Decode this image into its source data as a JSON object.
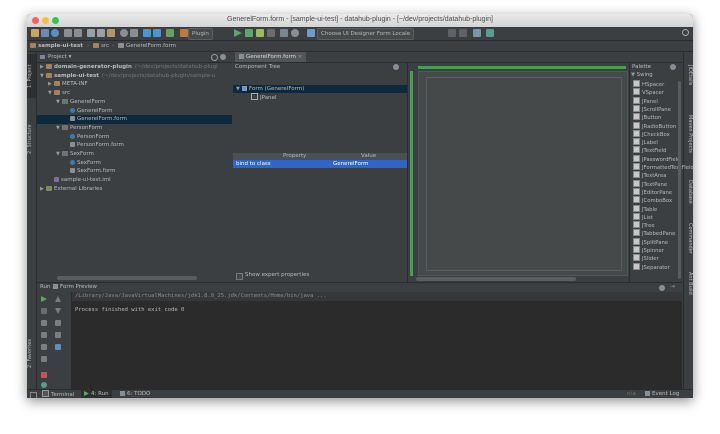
{
  "window": {
    "title": "GenerelForm.form - [sample-ui-test] - datahub-plugin - [~/dev/projects/datahub-plugin]"
  },
  "toolbar": {
    "plugin_combo": "Plugin",
    "locale_combo": "Choose UI Designer Form Locale"
  },
  "breadcrumb": {
    "items": [
      "sample-ui-test",
      "src",
      "GenerelForm.form"
    ]
  },
  "left_stripe": {
    "tabs": [
      "1: Project",
      "2: Structure",
      "2: Favorites"
    ]
  },
  "right_stripe": {
    "tabs": [
      "JIDEtails",
      "Maven Projects",
      "Database",
      "Commander",
      "Ant Build"
    ]
  },
  "project_panel": {
    "view_combo": "Project",
    "tree": [
      {
        "label": "domain-generator-plugin",
        "hint": "(~/dev/projects/datahub-plugi",
        "type": "folder",
        "indent": 0,
        "arrow": "right",
        "bold": true
      },
      {
        "label": "sample-ui-test",
        "hint": "(~/dev/projects/datahub-plugin/sample-u",
        "type": "folder",
        "indent": 0,
        "arrow": "down",
        "bold": true
      },
      {
        "label": "META-INF",
        "hint": "",
        "type": "folder",
        "indent": 1,
        "arrow": "right"
      },
      {
        "label": "src",
        "hint": "",
        "type": "folder",
        "indent": 1,
        "arrow": "down"
      },
      {
        "label": "GenerelForm",
        "hint": "",
        "type": "pkg",
        "indent": 2,
        "arrow": "down"
      },
      {
        "label": "GenerelForm",
        "hint": "",
        "type": "cls",
        "indent": 3,
        "arrow": ""
      },
      {
        "label": "GenerelForm.form",
        "hint": "",
        "type": "form",
        "indent": 3,
        "arrow": "",
        "selected": true
      },
      {
        "label": "PersonForm",
        "hint": "",
        "type": "pkg",
        "indent": 2,
        "arrow": "down"
      },
      {
        "label": "PersonForm",
        "hint": "",
        "type": "cls",
        "indent": 3,
        "arrow": ""
      },
      {
        "label": "PersonForm.form",
        "hint": "",
        "type": "form",
        "indent": 3,
        "arrow": ""
      },
      {
        "label": "SexForm",
        "hint": "",
        "type": "pkg",
        "indent": 2,
        "arrow": "down"
      },
      {
        "label": "SexForm",
        "hint": "",
        "type": "cls",
        "indent": 3,
        "arrow": ""
      },
      {
        "label": "SexForm.form",
        "hint": "",
        "type": "form",
        "indent": 3,
        "arrow": ""
      },
      {
        "label": "sample-ui-test.iml",
        "hint": "",
        "type": "iml",
        "indent": 1,
        "arrow": ""
      },
      {
        "label": "External Libraries",
        "hint": "",
        "type": "lib",
        "indent": 0,
        "arrow": "right"
      }
    ]
  },
  "editor": {
    "tab_label": "GenerelForm.form"
  },
  "component_tree": {
    "title": "Component Tree",
    "items": [
      {
        "label": "Form (GenerelForm)",
        "indent": 0,
        "selected": true
      },
      {
        "label": "JPanel",
        "indent": 1,
        "selected": false
      }
    ],
    "property_header": "Property",
    "value_header": "Value",
    "property_row": {
      "name": "bind to class",
      "value": "GenerelForm"
    },
    "show_expert_label": "Show expert properties"
  },
  "palette": {
    "title": "Palette",
    "group": "Swing",
    "items": [
      "HSpacer",
      "VSpacer",
      "JPanel",
      "JScrollPane",
      "JButton",
      "JRadioButton",
      "JCheckBox",
      "JLabel",
      "JTextField",
      "JPasswordField",
      "JFormattedTextField",
      "JTextArea",
      "JTextPane",
      "JEditorPane",
      "JComboBox",
      "JTable",
      "JList",
      "JTree",
      "JTabbedPane",
      "JSplitPane",
      "JSpinner",
      "JSlider",
      "JSeparator"
    ]
  },
  "run_panel": {
    "run_label": "Run",
    "config_label": "Form Preview",
    "command": "/Library/Java/JavaVirtualMachines/jdk1.8.0_25.jdk/Contents/Home/bin/java ...",
    "output": "Process finished with exit code 0"
  },
  "statusbar": {
    "tabs": [
      "Terminal",
      "4: Run",
      "6: TODO"
    ],
    "event_log": "Event Log",
    "position": "n/a"
  },
  "colors": {
    "green_bar": "#499c54",
    "selection": "#2f65ca",
    "tree_selection": "#0d293e"
  }
}
